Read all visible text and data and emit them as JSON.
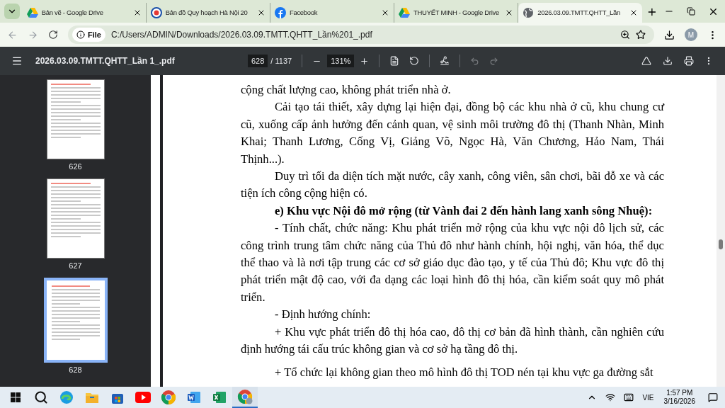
{
  "browser": {
    "tabs": [
      {
        "title": "Bản vẽ - Google Drive",
        "kind": "drive",
        "selected": false
      },
      {
        "title": "Bản đồ Quy hoạch Hà Nội 20",
        "kind": "map",
        "selected": false
      },
      {
        "title": "Facebook",
        "kind": "facebook",
        "selected": false
      },
      {
        "title": "THUYẾT MINH - Google Drive",
        "kind": "drive",
        "selected": false
      },
      {
        "title": "2026.03.09.TMTT.QHTT_Lần",
        "kind": "globe",
        "selected": true
      }
    ],
    "address": {
      "chip": "File",
      "url": "C:/Users/ADMIN/Downloads/2026.03.09.TMTT.QHTT_Lần%201_.pdf"
    },
    "profile": "M"
  },
  "pdf_toolbar": {
    "filename": "2026.03.09.TMTT.QHTT_Lần 1_.pdf",
    "page": "628",
    "page_total": "/ 1137",
    "zoom": "131%"
  },
  "thumbnails": [
    {
      "label": "626",
      "selected": false
    },
    {
      "label": "627",
      "selected": false
    },
    {
      "label": "628",
      "selected": true
    }
  ],
  "document": {
    "paragraphs": [
      {
        "text": "cộng chất lượng cao, không phát triển nhà ở.",
        "kind": "continuation"
      },
      {
        "text": "Cải tạo tái thiết, xây dựng lại hiện đại, đồng bộ các khu nhà ở cũ, khu chung cư cũ, xuống cấp ảnh hưởng đến cảnh quan, vệ sinh môi trường đô thị (Thanh Nhàn, Minh Khai; Thanh Lương, Cống Vị, Giảng Võ, Ngọc Hà, Văn Chương, Hảo Nam, Thái Thịnh...).",
        "kind": "body"
      },
      {
        "text": "Duy trì tối đa diện tích mặt nước, cây xanh, công viên, sân chơi, bãi đỗ xe và các tiện ích công cộng hiện có.",
        "kind": "body"
      },
      {
        "text": "e) Khu vực Nội đô mở rộng (từ Vành đai 2 đến hành lang xanh sông Nhuệ):",
        "kind": "heading"
      },
      {
        "text": "- Tính chất, chức năng: Khu phát triển mở rộng của khu vực nội đô lịch sử, các công trình trung tâm chức năng của Thủ đô như hành chính, hội nghị, văn hóa, thể dục thể thao và là nơi tập trung các cơ sở giáo dục đào tạo, y tế của Thủ đô; Khu vực đô thị phát triển mật độ cao, với đa dạng các loại hình đô thị hóa, cần kiểm soát quy mô phát triển.",
        "kind": "body"
      },
      {
        "text": "- Định hướng chính:",
        "kind": "body"
      },
      {
        "text": "+ Khu vực phát triển đô thị hóa cao, đô thị cơ bản đã hình thành, cần nghiên cứu định hướng tái cấu trúc không gian và cơ sở hạ tầng đô thị.",
        "kind": "body"
      },
      {
        "text": "+ Tổ chức lại không gian theo mô hình đô thị TOD nén tại khu vực ga đường sắt",
        "kind": "spaced"
      }
    ]
  },
  "taskbar": {
    "apps": [
      {
        "kind": "search"
      },
      {
        "kind": "edge"
      },
      {
        "kind": "folder"
      },
      {
        "kind": "store"
      },
      {
        "kind": "youtube"
      },
      {
        "kind": "chrome"
      },
      {
        "kind": "word"
      },
      {
        "kind": "excel"
      },
      {
        "kind": "chrome-profile"
      }
    ],
    "language": "VIE",
    "time": "1:57 PM",
    "date": "3/16/2026"
  }
}
